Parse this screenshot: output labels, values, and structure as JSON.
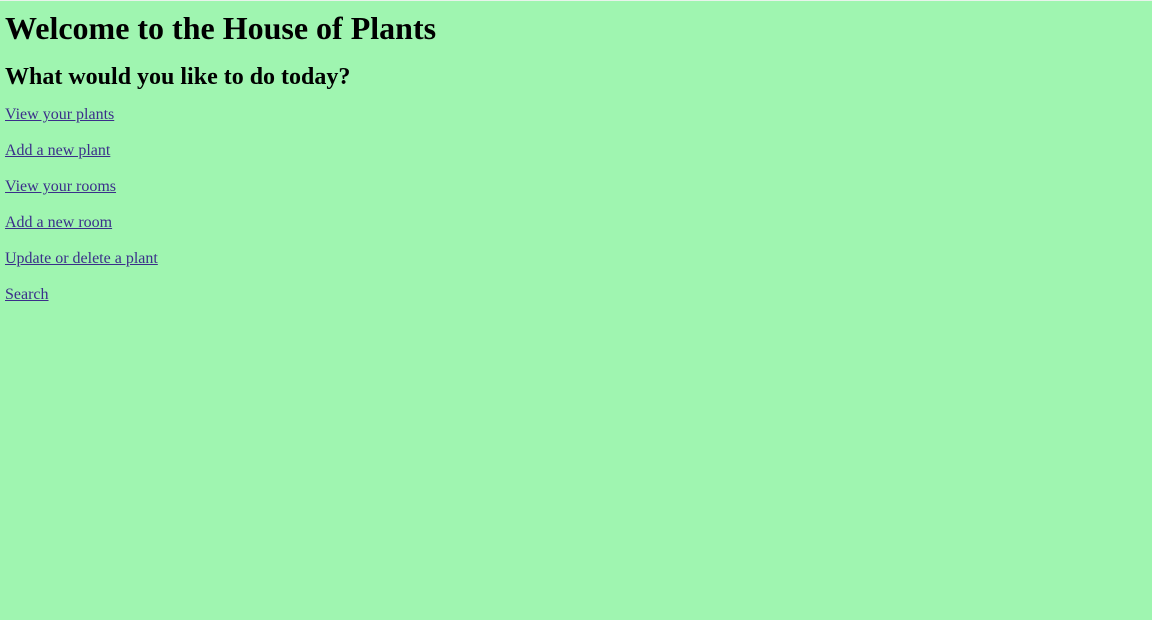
{
  "page": {
    "title": "Welcome to the House of Plants",
    "subtitle": "What would you like to do today?"
  },
  "links": [
    {
      "label": "View your plants"
    },
    {
      "label": "Add a new plant"
    },
    {
      "label": "View your rooms"
    },
    {
      "label": "Add a new room"
    },
    {
      "label": "Update or delete a plant"
    },
    {
      "label": "Search"
    }
  ],
  "colors": {
    "background": "#9ff5b0",
    "link": "#3b2f8a",
    "text": "#000000"
  }
}
